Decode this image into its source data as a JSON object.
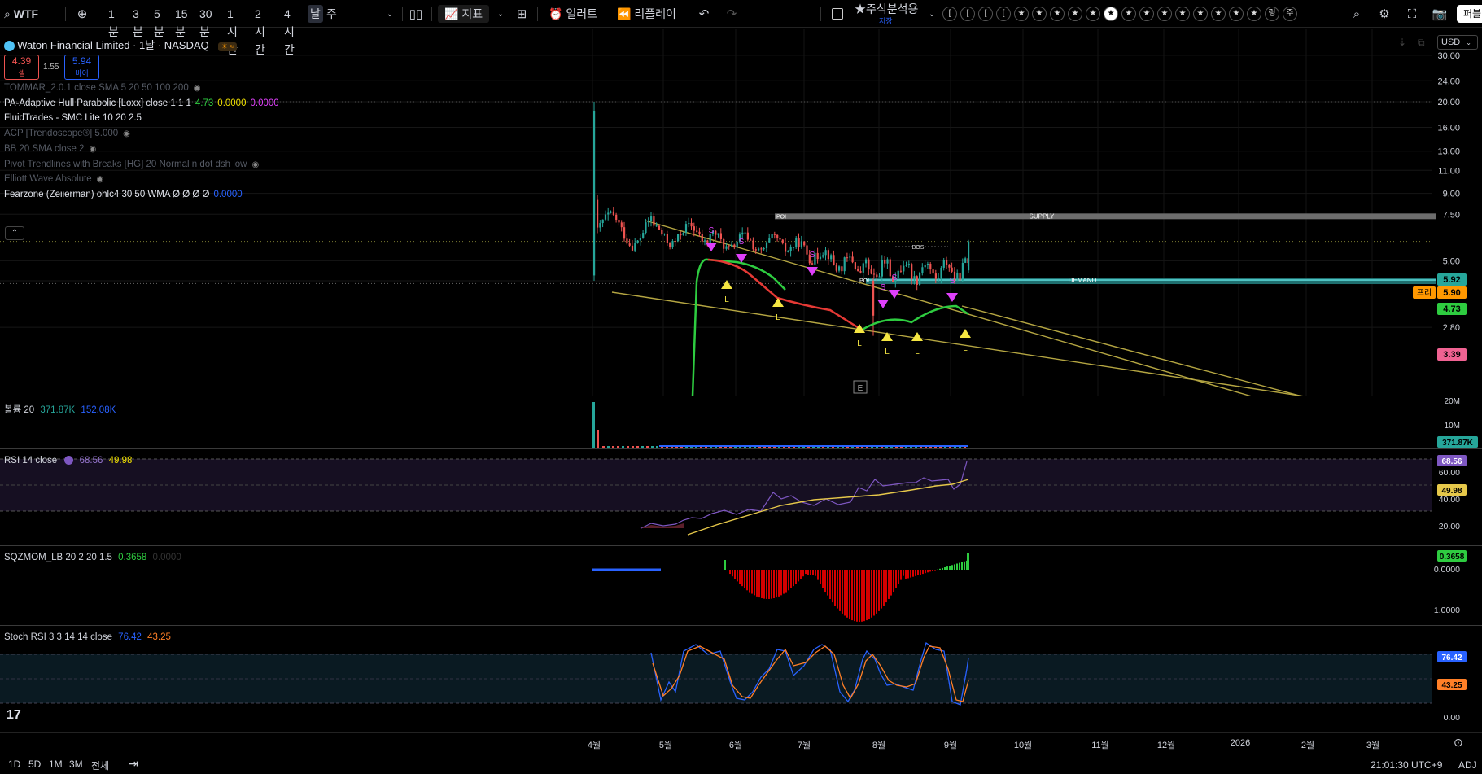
{
  "toolbar": {
    "symbol": "WTF",
    "intervals": [
      "1분",
      "3분",
      "5분",
      "15분",
      "30분",
      "1시간",
      "2시간",
      "4시간",
      "날",
      "주"
    ],
    "active_interval": "날",
    "indicators_label": "지표",
    "alert_label": "얼러트",
    "replay_label": "리플레이",
    "layout_name": "★주식분석용",
    "layout_sub": "저장",
    "star_buttons": [
      "[",
      "[",
      "[",
      "[",
      "★",
      "★",
      "★",
      "★",
      "★",
      "★",
      "★",
      "★",
      "★",
      "★",
      "★",
      "★",
      "★",
      "★",
      "링",
      "주"
    ],
    "right_button": "퍼블"
  },
  "header": {
    "title": "Waton Financial Limited · 1날 · NASDAQ",
    "sell_price": "4.39",
    "sell_label": "셀",
    "spread": "1.55",
    "buy_price": "5.94",
    "buy_label": "바이",
    "currency": "USD"
  },
  "legends": [
    {
      "text": "TOMMAR_2.0.1 close SMA 5 20 50 100 200",
      "dim": true,
      "eye": true
    },
    {
      "text": "PA-Adaptive Hull Parabolic [Loxx] close 1 1 1",
      "dim": false,
      "values": [
        "4.73",
        "0.0000",
        "0.0000"
      ],
      "value_colors": [
        "#2ecc40",
        "#f0e000",
        "#e040fb"
      ]
    },
    {
      "text": "FluidTrades - SMC Lite 10 20 2.5",
      "dim": false
    },
    {
      "text": "ACP [Trendoscope®] 5.000",
      "dim": true,
      "eye": true
    },
    {
      "text": "BB 20 SMA close 2",
      "dim": true,
      "eye": true
    },
    {
      "text": "Pivot Trendlines with Breaks [HG] 20 Normal n dot dsh low",
      "dim": true,
      "eye": true
    },
    {
      "text": "Elliott Wave Absolute",
      "dim": true,
      "eye": true
    },
    {
      "text": "Fearzone (Zeiierman) ohlc4 30 50 WMA  Ø Ø Ø Ø",
      "dim": false,
      "values": [
        "0.0000"
      ],
      "value_colors": [
        "#2962ff"
      ]
    }
  ],
  "price_axis": [
    "30.00",
    "24.00",
    "20.00",
    "16.00",
    "13.00",
    "11.00",
    "9.00",
    "7.50",
    "5.00",
    "4.20",
    "2.80"
  ],
  "price_badges": [
    {
      "label": "5.92",
      "color": "#26a69a"
    },
    {
      "label": "5.90",
      "color": "#ff9800",
      "tag": "프리"
    },
    {
      "label": "4.73",
      "color": "#2ecc40"
    },
    {
      "label": "3.39",
      "color": "#f06292"
    }
  ],
  "chart_labels": {
    "supply": "SUPPLY",
    "demand": "DEMAND",
    "poi_top": "POI",
    "poi_bottom": "POI",
    "bos": "BOS",
    "earnings": "E",
    "sell_marker": "S",
    "low_marker": "L"
  },
  "volume": {
    "legend": "볼륨 20",
    "v1": "371.87K",
    "v2": "152.08K",
    "axis": [
      "20M",
      "10M"
    ],
    "badge": "371.87K"
  },
  "rsi": {
    "legend": "RSI 14 close",
    "v1": "68.56",
    "v2": "49.98",
    "axis": [
      "60.00",
      "40.00",
      "20.00"
    ],
    "badge1": "68.56",
    "badge2": "49.98"
  },
  "sqz": {
    "legend": "SQZMOM_LB 20 2 20 1.5",
    "v1": "0.3658",
    "v2": "0.0000",
    "axis": [
      "0.0000",
      "−1.0000"
    ],
    "badge": "0.3658"
  },
  "stoch": {
    "legend": "Stoch RSI 3 3 14 14 close",
    "v1": "76.42",
    "v2": "43.25",
    "axis": [
      "0.00"
    ],
    "badge1": "76.42",
    "badge2": "43.25"
  },
  "time_axis": [
    "4월",
    "5월",
    "6월",
    "7월",
    "8월",
    "9월",
    "10월",
    "11월",
    "12월",
    "2026",
    "2월",
    "3월"
  ],
  "bottom": {
    "ranges": [
      "1D",
      "5D",
      "1M",
      "3M",
      "전체"
    ],
    "clock": "21:01:30 UTC+9",
    "adj": "ADJ"
  },
  "colors": {
    "up": "#26a69a",
    "down": "#ef5350",
    "rsi_line": "#7e57c2",
    "rsi_ma": "#e6c84a",
    "stoch_k": "#2962ff",
    "stoch_d": "#ff7f27",
    "trendline": "#b5a642"
  }
}
